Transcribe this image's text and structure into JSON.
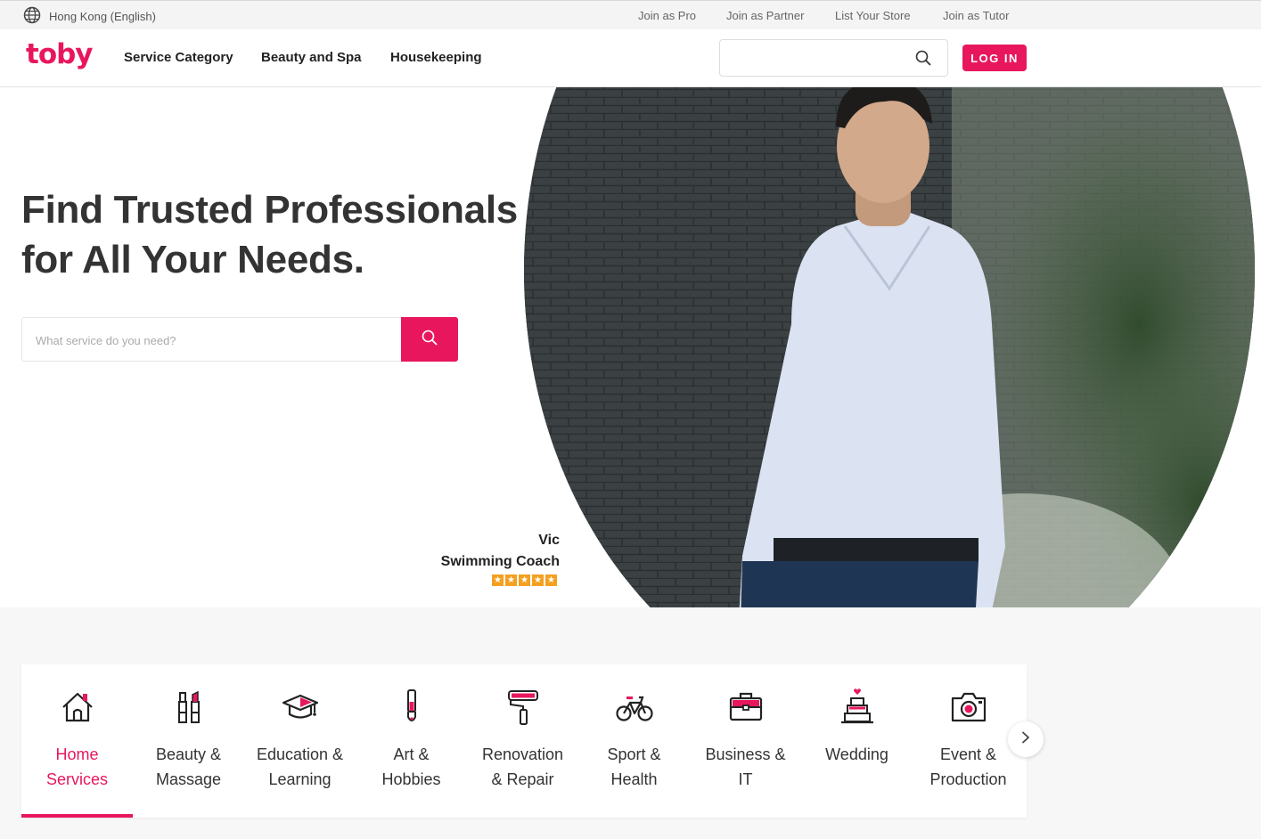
{
  "topbar": {
    "region_label": "Hong Kong (English)",
    "links": [
      "Join as Pro",
      "Join as Partner",
      "List Your Store",
      "Join as Tutor"
    ]
  },
  "header": {
    "logo_text": "toby",
    "nav": [
      "Service Category",
      "Beauty and Spa",
      "Housekeeping"
    ],
    "search_placeholder": "",
    "login_label": "LOG IN"
  },
  "hero": {
    "title_line1": "Find Trusted Professionals",
    "title_line2": "for All Your Needs.",
    "search_placeholder": "What service do you need?",
    "featured_pro": {
      "name": "Vic",
      "title": "Swimming Coach",
      "rating_stars": 5
    }
  },
  "categories": [
    {
      "line1": "Home",
      "line2": "Services",
      "icon": "house-icon",
      "active": true
    },
    {
      "line1": "Beauty &",
      "line2": "Massage",
      "icon": "cosmetics-icon",
      "active": false
    },
    {
      "line1": "Education &",
      "line2": "Learning",
      "icon": "graduation-cap-icon",
      "active": false
    },
    {
      "line1": "Art &",
      "line2": "Hobbies",
      "icon": "paintbrush-icon",
      "active": false
    },
    {
      "line1": "Renovation",
      "line2": "& Repair",
      "icon": "paint-roller-icon",
      "active": false
    },
    {
      "line1": "Sport &",
      "line2": "Health",
      "icon": "bicycle-icon",
      "active": false
    },
    {
      "line1": "Business &",
      "line2": "IT",
      "icon": "briefcase-icon",
      "active": false
    },
    {
      "line1": "Wedding",
      "line2": "",
      "icon": "wedding-cake-icon",
      "active": false
    },
    {
      "line1": "Event &",
      "line2": "Production",
      "icon": "camera-icon",
      "active": false
    }
  ],
  "colors": {
    "brand": "#e8175d",
    "star": "#f4a020",
    "text": "#333333"
  }
}
